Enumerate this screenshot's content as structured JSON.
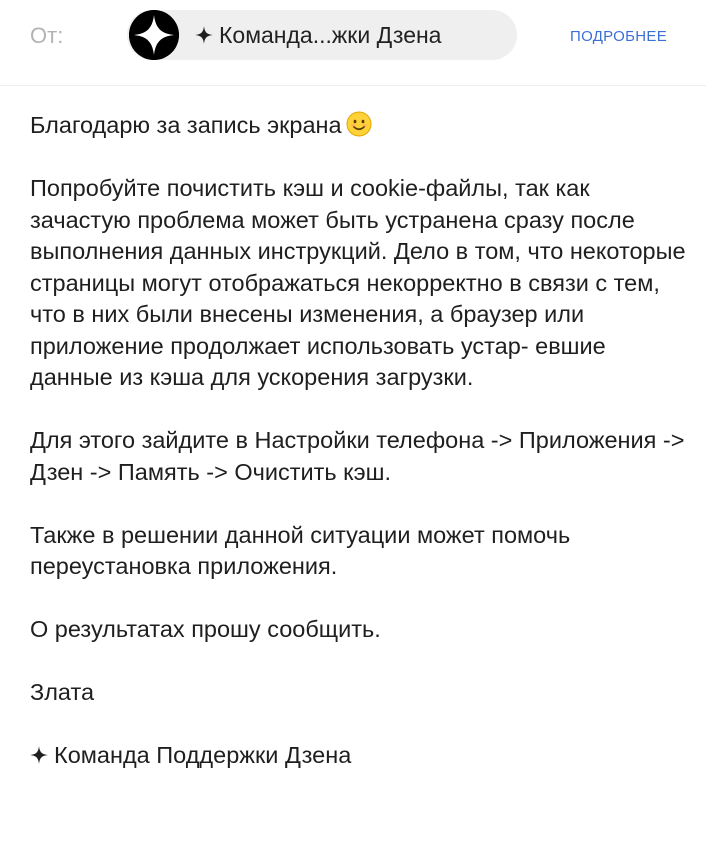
{
  "header": {
    "from_label": "От:",
    "sender_display": "Команда...жки Дзена",
    "details_link": "Подробнее"
  },
  "message": {
    "greeting": "Благодарю за запись экрана",
    "greeting_emoji": "smiling-face-emoji",
    "paragraphs": [
      "Попробуйте почистить кэш и cookie-файлы, так как зачастую проблема может быть устранена сразу после выполнения данных инструкций. Дело в том, что некоторые страницы могут отображаться некорректно в связи с тем, что в них были внесены изменения, а браузер или приложение продолжает использовать устар- евшие данные из кэша для ускорения загрузки.",
      "Для этого зайдите в Настройки телефона -> Приложения -> Дзен -> Память -> Очистить кэш.",
      "Также в решении данной ситуации может помочь переустановка приложения.",
      "О результатах прошу сообщить."
    ],
    "signature_name": "Злата",
    "signature_team": "Команда Поддержки Дзена"
  },
  "colors": {
    "link": "#3a6fd8",
    "chip_background": "#efefef",
    "muted_label": "#b3b3b3"
  },
  "icons": {
    "avatar": "zen-logo-avatar",
    "sender_prefix": "sparkle-star-icon"
  }
}
